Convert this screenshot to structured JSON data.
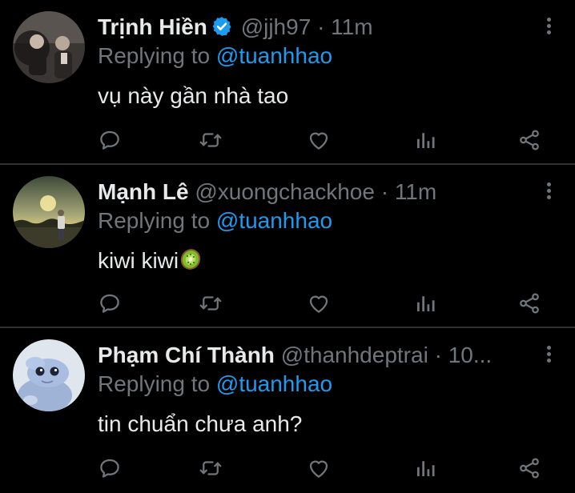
{
  "tweets": [
    {
      "name": "Trịnh Hiền",
      "handle": "@jjh97",
      "sep": "·",
      "time": "11m",
      "verified": true,
      "replying_prefix": "Replying to",
      "replying_to": "@tuanhhao",
      "text": "vụ này gần nhà tao"
    },
    {
      "name": "Mạnh Lê",
      "handle": "@xuongchackhoe",
      "sep": "·",
      "time": "11m",
      "verified": false,
      "replying_prefix": "Replying to",
      "replying_to": "@tuanhhao",
      "text": "kiwi kiwi",
      "emoji": "kiwi-fruit"
    },
    {
      "name": "Phạm Chí Thành",
      "handle": "@thanhdeptrai",
      "sep": "·",
      "time": "10...",
      "verified": false,
      "replying_prefix": "Replying to",
      "replying_to": "@tuanhhao",
      "text": "tin chuẩn chưa anh?"
    }
  ],
  "action_icons": [
    "reply-icon",
    "retweet-icon",
    "like-icon",
    "analytics-icon",
    "share-icon"
  ],
  "colors": {
    "background": "#000000",
    "text": "#e7e9ea",
    "muted": "#71767b",
    "accent": "#1d9bf0",
    "divider": "#2f3336"
  }
}
